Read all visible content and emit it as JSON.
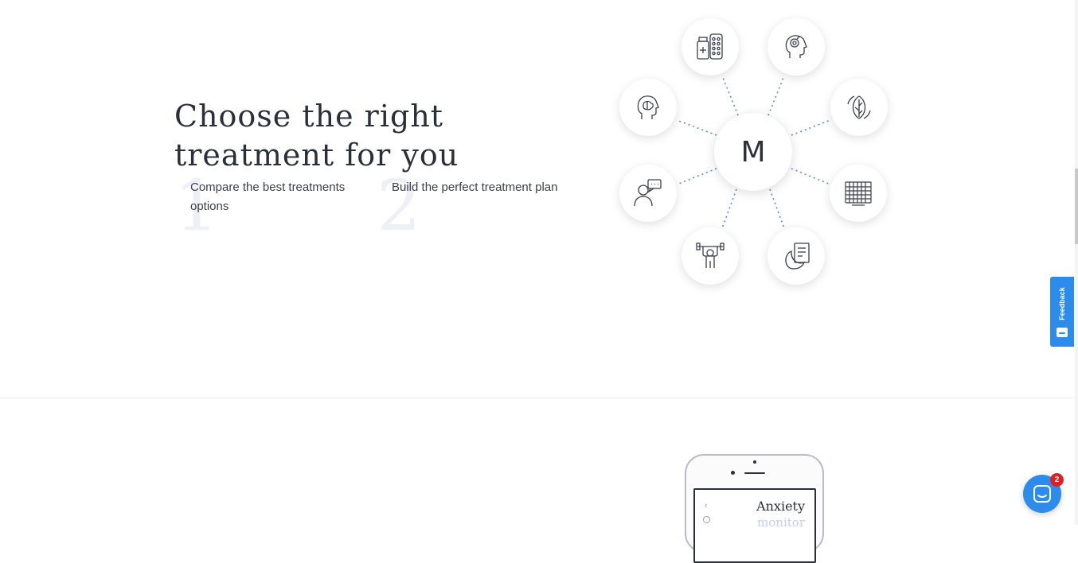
{
  "hero": {
    "heading_line1": "Choose the right",
    "heading_line2": "treatment for you"
  },
  "steps": [
    {
      "number": "1",
      "text_line1": "Compare the best treatments",
      "text_line2": "options"
    },
    {
      "number": "2",
      "text_line1": "Build the perfect treatment plan",
      "text_line2": ""
    }
  ],
  "diagram": {
    "center_label": "M",
    "nodes": [
      {
        "icon": "medication-icon"
      },
      {
        "icon": "mind-head-icon"
      },
      {
        "icon": "brain-head-icon"
      },
      {
        "icon": "leaf-cycle-icon"
      },
      {
        "icon": "therapist-chat-icon"
      },
      {
        "icon": "calendar-grid-icon"
      },
      {
        "icon": "exercise-weights-icon"
      },
      {
        "icon": "sleep-diet-icon"
      }
    ],
    "line_color": "#4a90e2"
  },
  "feedback": {
    "label": "Feedback",
    "color": "#2d8ceb"
  },
  "phone": {
    "screen_title": "Anxiety",
    "screen_subtitle": "monitor",
    "back_glyph": "‹"
  },
  "chat": {
    "badge_count": "2",
    "color": "#2d8ceb",
    "badge_color": "#e02020"
  }
}
